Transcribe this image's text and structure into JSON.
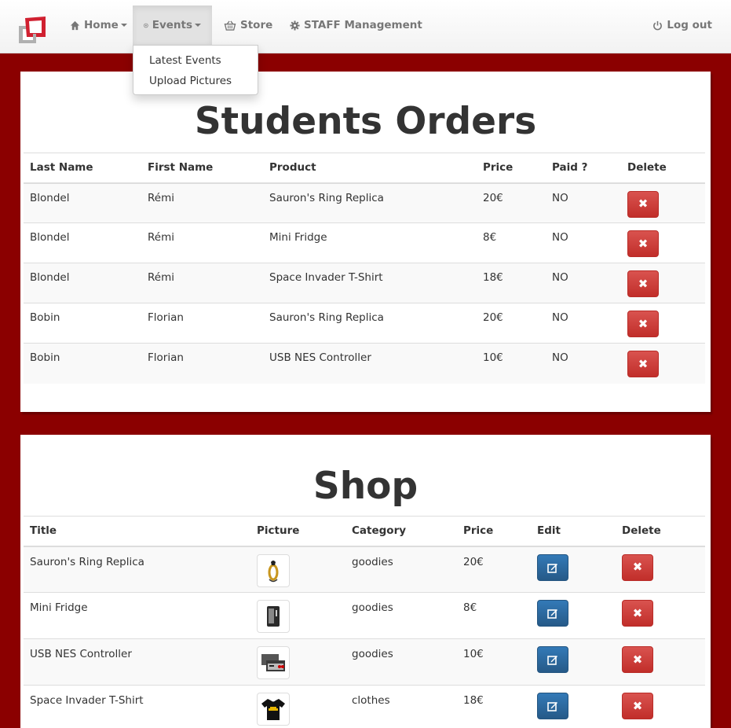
{
  "navbar": {
    "home": "Home",
    "events": "Events",
    "store": "Store",
    "staff": "STAFF Management",
    "logout": "Log out",
    "events_menu": [
      "Latest Events",
      "Upload Pictures"
    ]
  },
  "orders": {
    "title": "Students Orders",
    "headers": [
      "Last Name",
      "First Name",
      "Product",
      "Price",
      "Paid ?",
      "Delete"
    ],
    "rows": [
      {
        "last": "Blondel",
        "first": "Rémi",
        "product": "Sauron's Ring Replica",
        "price": "20€",
        "paid": "NO"
      },
      {
        "last": "Blondel",
        "first": "Rémi",
        "product": "Mini Fridge",
        "price": "8€",
        "paid": "NO"
      },
      {
        "last": "Blondel",
        "first": "Rémi",
        "product": "Space Invader T-Shirt",
        "price": "18€",
        "paid": "NO"
      },
      {
        "last": "Bobin",
        "first": "Florian",
        "product": "Sauron's Ring Replica",
        "price": "20€",
        "paid": "NO"
      },
      {
        "last": "Bobin",
        "first": "Florian",
        "product": "USB NES Controller",
        "price": "10€",
        "paid": "NO"
      }
    ]
  },
  "shop": {
    "title": "Shop",
    "headers": [
      "Title",
      "Picture",
      "Category",
      "Price",
      "Edit",
      "Delete"
    ],
    "rows": [
      {
        "title": "Sauron's Ring Replica",
        "category": "goodies",
        "price": "20€",
        "picture": "ring-picture"
      },
      {
        "title": "Mini Fridge",
        "category": "goodies",
        "price": "8€",
        "picture": "fridge-picture"
      },
      {
        "title": "USB NES Controller",
        "category": "goodies",
        "price": "10€",
        "picture": "controller-picture"
      },
      {
        "title": "Space Invader T-Shirt",
        "category": "clothes",
        "price": "18€",
        "picture": "tshirt-picture"
      }
    ]
  },
  "colors": {
    "background": "#8b0000",
    "danger": "#d9534f",
    "primary": "#337ab7"
  }
}
